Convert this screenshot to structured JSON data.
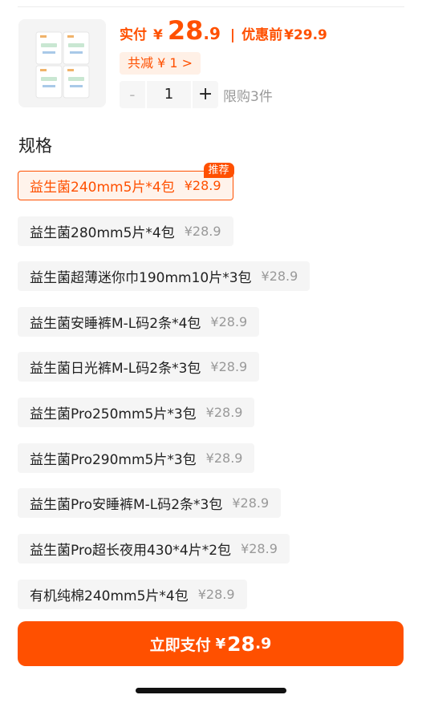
{
  "product": {
    "price_label": "实付",
    "currency": "¥",
    "price_int": "28",
    "price_dec": ".9",
    "separator": "|",
    "original_label": "优惠前",
    "original_price": "¥29.9",
    "discount": "共减 ¥ 1 >"
  },
  "quantity": {
    "minus": "-",
    "value": "1",
    "plus": "+",
    "limit": "限购3件"
  },
  "spec_section_title": "规格",
  "specs": [
    {
      "name": "益生菌240mm5片*4包",
      "price": "¥28.9",
      "selected": true,
      "tag": "推荐"
    },
    {
      "name": "益生菌280mm5片*4包",
      "price": "¥28.9"
    },
    {
      "name": "益生菌超薄迷你巾190mm10片*3包",
      "price": "¥28.9"
    },
    {
      "name": "益生菌安睡裤M-L码2条*4包",
      "price": "¥28.9"
    },
    {
      "name": "益生菌日光裤M-L码2条*3包",
      "price": "¥28.9"
    },
    {
      "name": "益生菌Pro250mm5片*3包",
      "price": "¥28.9"
    },
    {
      "name": "益生菌Pro290mm5片*3包",
      "price": "¥28.9"
    },
    {
      "name": "益生菌Pro安睡裤M-L码2条*3包",
      "price": "¥28.9"
    },
    {
      "name": "益生菌Pro超长夜用430*4片*2包",
      "price": "¥28.9"
    },
    {
      "name": "有机纯棉240mm5片*4包",
      "price": "¥28.9"
    }
  ],
  "pay": {
    "label": "立即支付",
    "currency": "¥",
    "price_int": "28",
    "price_dec": ".9"
  },
  "colors": {
    "accent": "#ff5000",
    "accent_bg": "#fff3eb",
    "chip_bg": "#f5f5f5"
  }
}
